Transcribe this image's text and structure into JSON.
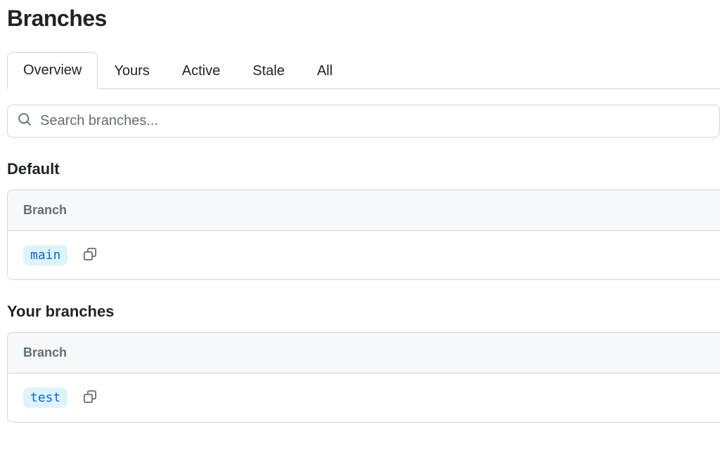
{
  "page": {
    "title": "Branches"
  },
  "tabs": [
    {
      "label": "Overview",
      "selected": true
    },
    {
      "label": "Yours",
      "selected": false
    },
    {
      "label": "Active",
      "selected": false
    },
    {
      "label": "Stale",
      "selected": false
    },
    {
      "label": "All",
      "selected": false
    }
  ],
  "search": {
    "placeholder": "Search branches..."
  },
  "sections": {
    "default": {
      "title": "Default",
      "column_header": "Branch",
      "branch_name": "main"
    },
    "yours": {
      "title": "Your branches",
      "column_header": "Branch",
      "branch_name": "test"
    }
  }
}
